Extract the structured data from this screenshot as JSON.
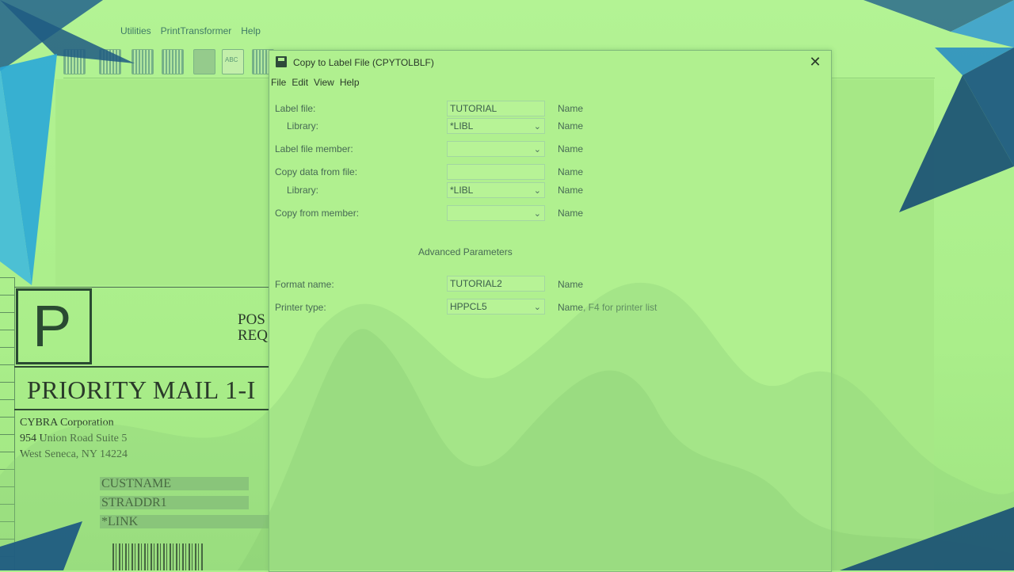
{
  "app": {
    "menu": [
      "Utilities",
      "PrintTransformer",
      "Help"
    ]
  },
  "label_preview": {
    "p_letter": "P",
    "post_text": "POS\nREQ",
    "priority_title": "PRIORITY MAIL 1-I",
    "address": [
      "CYBRA Corporation",
      "954 Union Road Suite 5",
      "West Seneca, NY 14224"
    ],
    "fields": [
      "CUSTNAME",
      "STRADDR1",
      "*LINK"
    ]
  },
  "dialog": {
    "title": "Copy to Label File (CPYTOLBLF)",
    "close": "✕",
    "menu": [
      "File",
      "Edit",
      "View",
      "Help"
    ],
    "fields": {
      "label_file": {
        "label": "Label file:",
        "value": "TUTORIAL",
        "hint": "Name"
      },
      "label_library": {
        "label": "Library:",
        "value": "*LIBL",
        "hint": "Name"
      },
      "label_member": {
        "label": "Label file member:",
        "value": "",
        "hint": "Name"
      },
      "copy_from_file": {
        "label": "Copy data from file:",
        "value": "",
        "hint": "Name"
      },
      "copy_library": {
        "label": "Library:",
        "value": "*LIBL",
        "hint": "Name"
      },
      "copy_member": {
        "label": "Copy from member:",
        "value": "",
        "hint": "Name"
      },
      "format_name": {
        "label": "Format name:",
        "value": "TUTORIAL2",
        "hint": "Name"
      },
      "printer_type": {
        "label": "Printer type:",
        "value": "HPPCL5",
        "hint": "Name, F4 for printer list"
      }
    },
    "advanced_title": "Advanced Parameters"
  },
  "colors": {
    "overlay_green": "#aef08e",
    "triangle_dark": "#1f5b82",
    "triangle_light": "#2aa8d8"
  },
  "icons": [
    "window-icon",
    "close-icon",
    "chevron-down-icon",
    "toolbar-icons"
  ]
}
